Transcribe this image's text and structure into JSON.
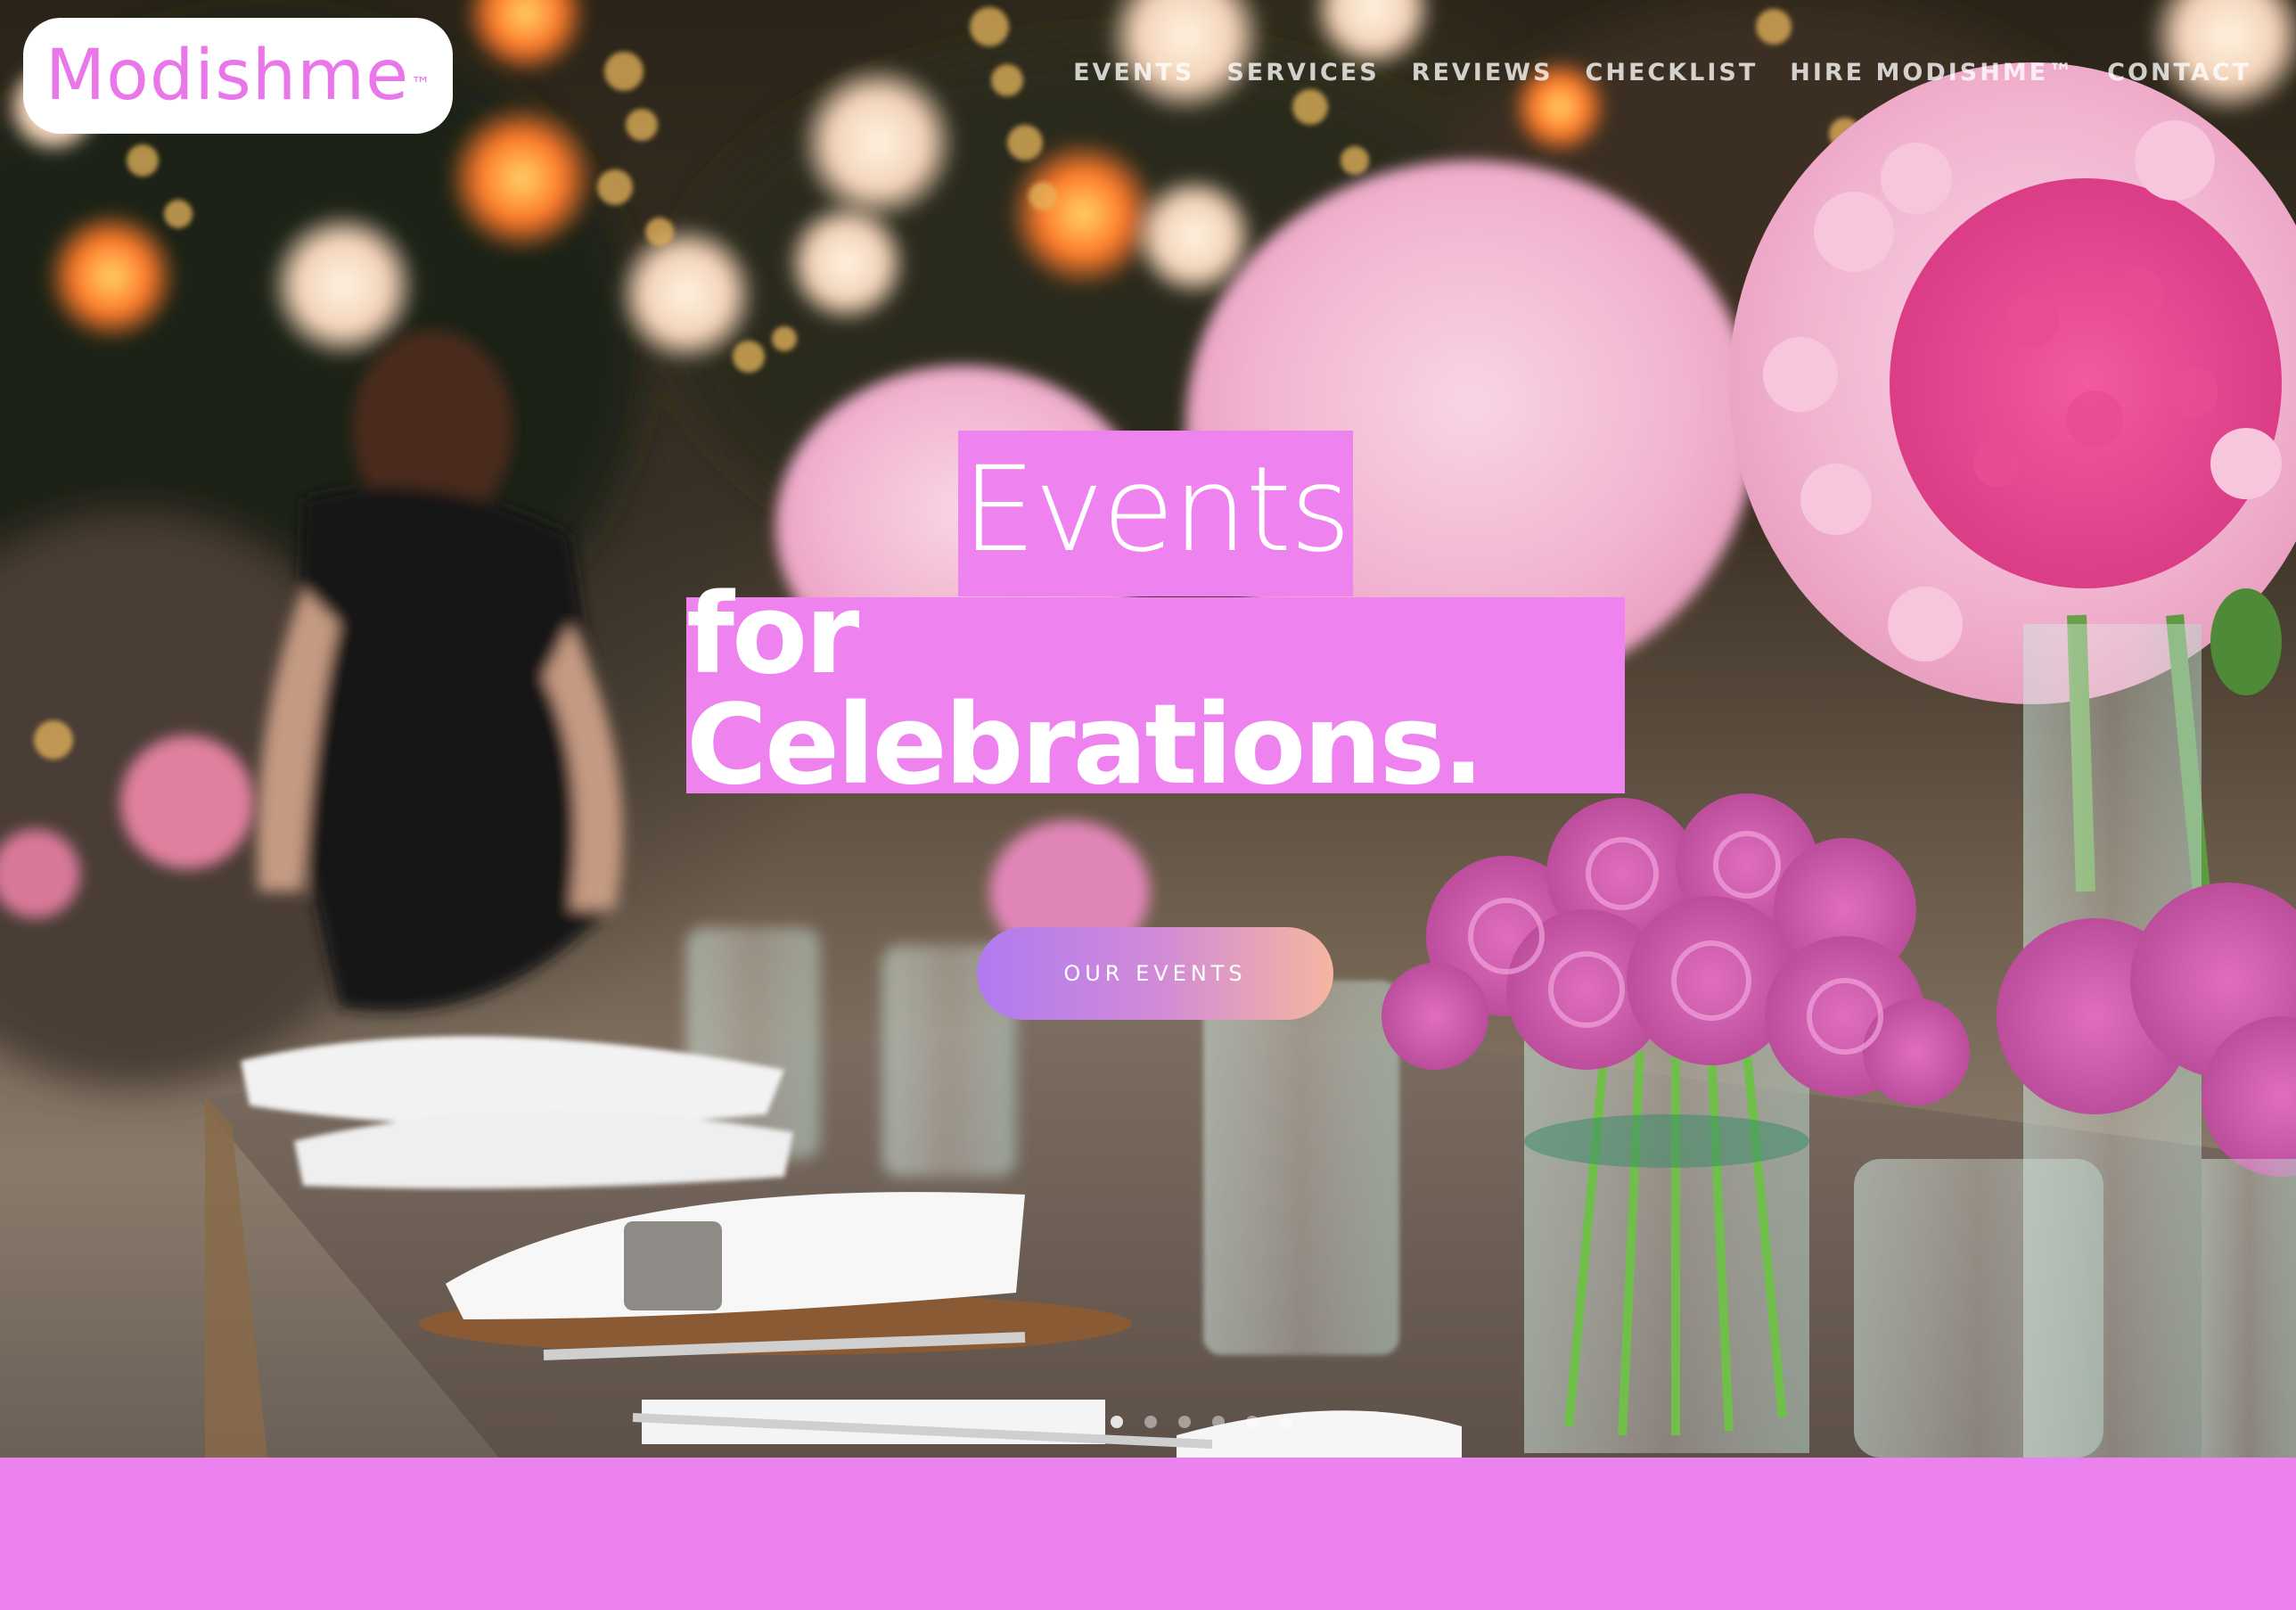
{
  "brand": {
    "name": "Modishme",
    "trademark": "™"
  },
  "nav": {
    "items": [
      {
        "label": "EVENTS"
      },
      {
        "label": "SERVICES"
      },
      {
        "label": "REVIEWS"
      },
      {
        "label": "CHECKLIST"
      },
      {
        "label": "HIRE MODISHME™"
      },
      {
        "label": "CONTACT"
      }
    ]
  },
  "hero": {
    "headline_line1": "Events",
    "headline_line2": "for Celebrations.",
    "cta_label": "OUR EVENTS",
    "slide_count": 6,
    "active_slide": 1
  },
  "colors": {
    "accent": "#ee82ee",
    "logo_text": "#e977ea",
    "cta_gradient_start": "#b07af0",
    "cta_gradient_end": "#f5b6a0",
    "band": "#ec82ed"
  }
}
